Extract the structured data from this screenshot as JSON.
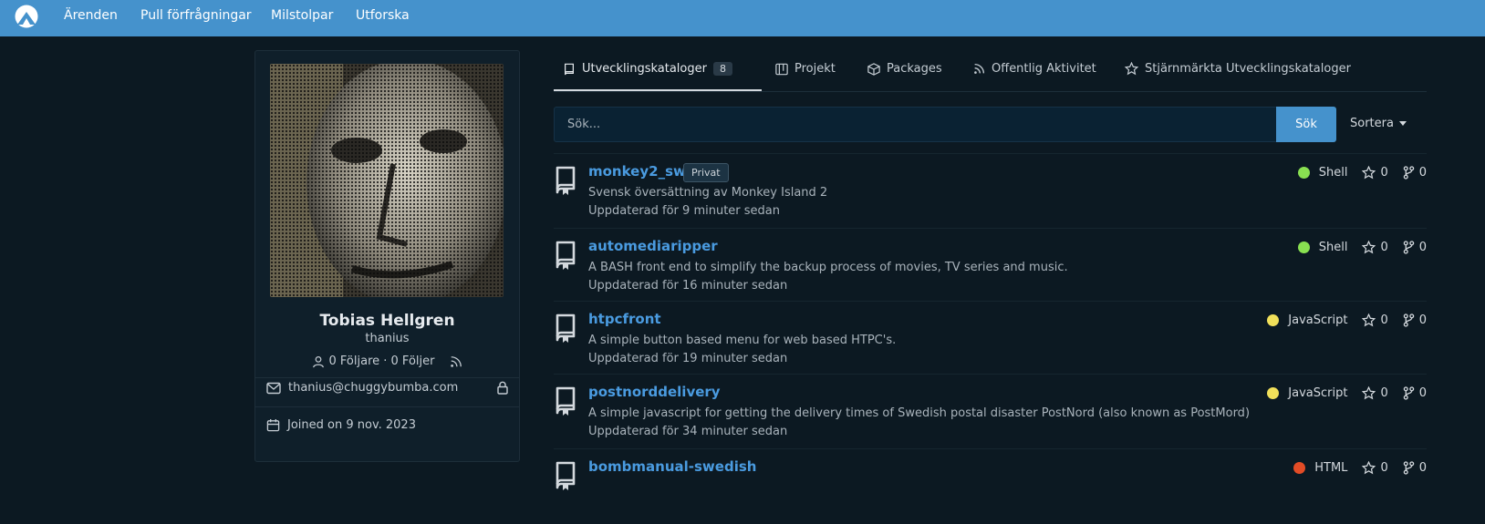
{
  "nav": {
    "items": [
      "Ärenden",
      "Pull förfrågningar",
      "Milstolpar",
      "Utforska"
    ]
  },
  "profile": {
    "full_name": "Tobias Hellgren",
    "username": "thanius",
    "followers_text": "0 Följare · 0 Följer",
    "email": "thanius@chuggybumba.com",
    "joined": "Joined on 9 nov. 2023"
  },
  "tabs": [
    {
      "label": "Utvecklingskataloger",
      "count": "8",
      "icon": "repo-icon"
    },
    {
      "label": "Projekt",
      "icon": "project-icon"
    },
    {
      "label": "Packages",
      "icon": "package-icon"
    },
    {
      "label": "Offentlig Aktivitet",
      "icon": "rss-icon"
    },
    {
      "label": "Stjärnmärkta Utvecklingskataloger",
      "icon": "star-icon"
    }
  ],
  "search": {
    "placeholder": "Sök...",
    "button_label": "Sök",
    "sort_label": "Sortera"
  },
  "repos": [
    {
      "name": "monkey2_swe",
      "badge": "Privat",
      "description": "Svensk översättning av Monkey Island 2",
      "updated": "Uppdaterad för 9 minuter sedan",
      "language": "Shell",
      "lang_color": "#89e051",
      "stars": "0",
      "forks": "0"
    },
    {
      "name": "automediaripper",
      "badge": "",
      "description": "A BASH front end to simplify the backup process of movies, TV series and music.",
      "updated": "Uppdaterad för 16 minuter sedan",
      "language": "Shell",
      "lang_color": "#89e051",
      "stars": "0",
      "forks": "0"
    },
    {
      "name": "htpcfront",
      "badge": "",
      "description": "A simple button based menu for web based HTPC's.",
      "updated": "Uppdaterad för 19 minuter sedan",
      "language": "JavaScript",
      "lang_color": "#f1e05a",
      "stars": "0",
      "forks": "0"
    },
    {
      "name": "postnorddelivery",
      "badge": "",
      "description": "A simple javascript for getting the delivery times of Swedish postal disaster PostNord (also known as PostMord)",
      "updated": "Uppdaterad för 34 minuter sedan",
      "language": "JavaScript",
      "lang_color": "#f1e05a",
      "stars": "0",
      "forks": "0"
    },
    {
      "name": "bombmanual-swedish",
      "badge": "",
      "description": "",
      "updated": "",
      "language": "HTML",
      "lang_color": "#e34c26",
      "stars": "0",
      "forks": "0"
    }
  ]
}
